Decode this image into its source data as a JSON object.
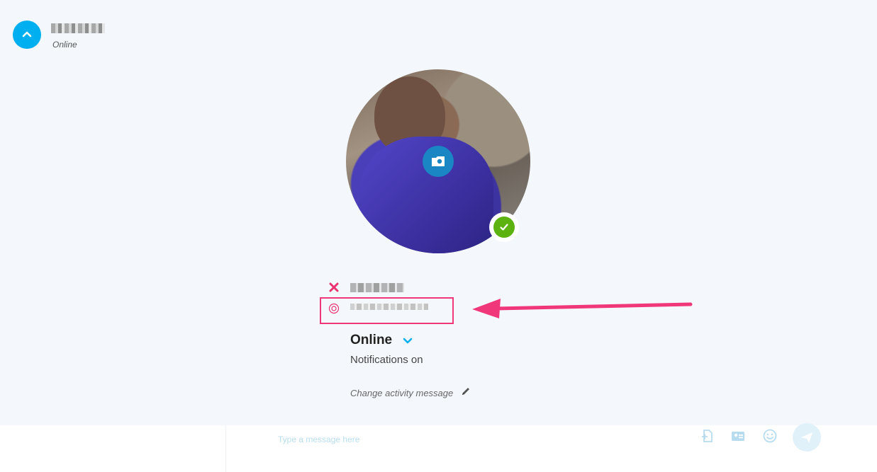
{
  "header": {
    "status": "Online"
  },
  "profile": {
    "status": "Online",
    "notifications": "Notifications on",
    "activity_placeholder": "Change activity message"
  },
  "compose": {
    "placeholder": "Type a message here"
  },
  "colors": {
    "accent": "#00aff0",
    "presence_online": "#5cb30f",
    "annotation": "#f0377a"
  },
  "icons": {
    "collapse": "chevron-up-icon",
    "camera": "camera-icon",
    "presence": "checkmark-icon",
    "remove": "x-icon",
    "skype": "skype-icon",
    "status_dropdown": "chevron-down-icon",
    "edit": "pencil-icon",
    "file": "file-icon",
    "contact_card": "contact-card-icon",
    "emoticon": "emoticon-icon",
    "send": "send-icon"
  }
}
